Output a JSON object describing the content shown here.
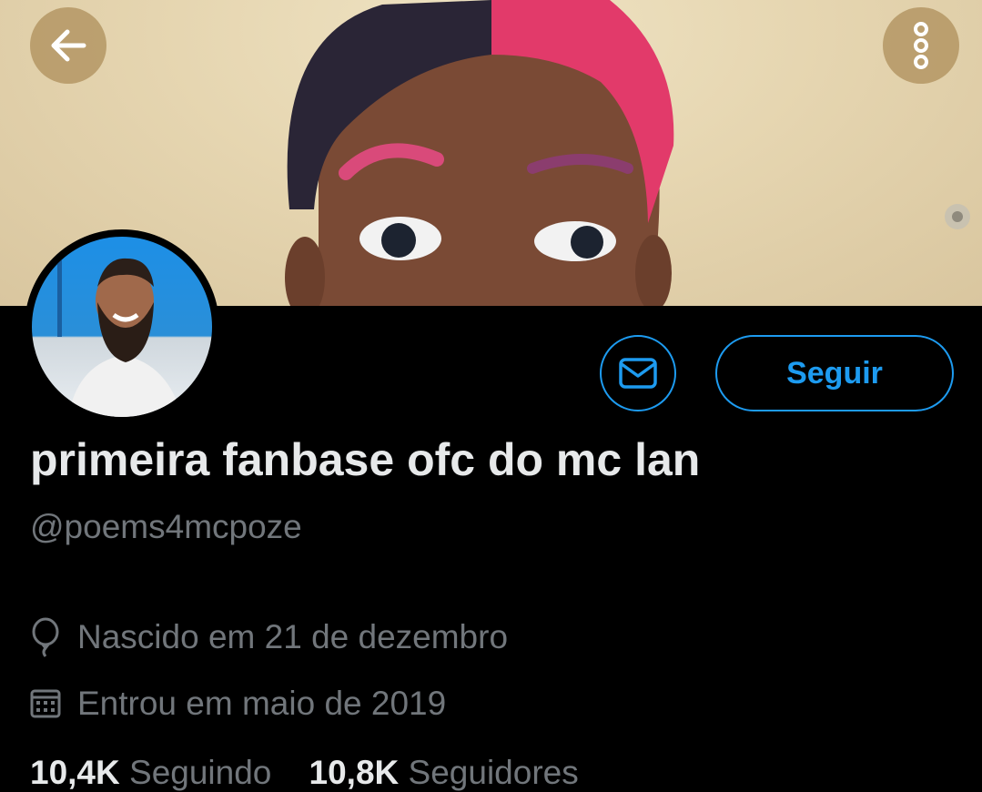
{
  "profile": {
    "display_name": "primeira fanbase ofc do mc lan",
    "handle": "@poems4mcpoze",
    "birthday": "Nascido em 21 de dezembro",
    "joined": "Entrou em maio de 2019",
    "follow_label": "Seguir",
    "following_count": "10,4K",
    "following_label": "Seguindo",
    "followers_count": "10,8K",
    "followers_label": "Seguidores"
  },
  "icons": {
    "back": "arrow-left-icon",
    "more": "more-vertical-icon",
    "message": "envelope-icon",
    "birthday": "balloon-icon",
    "joined": "calendar-icon"
  },
  "colors": {
    "accent": "#1d9bf0",
    "background": "#000000",
    "primary_text": "#e7e9ea",
    "secondary_text": "#71767b"
  }
}
